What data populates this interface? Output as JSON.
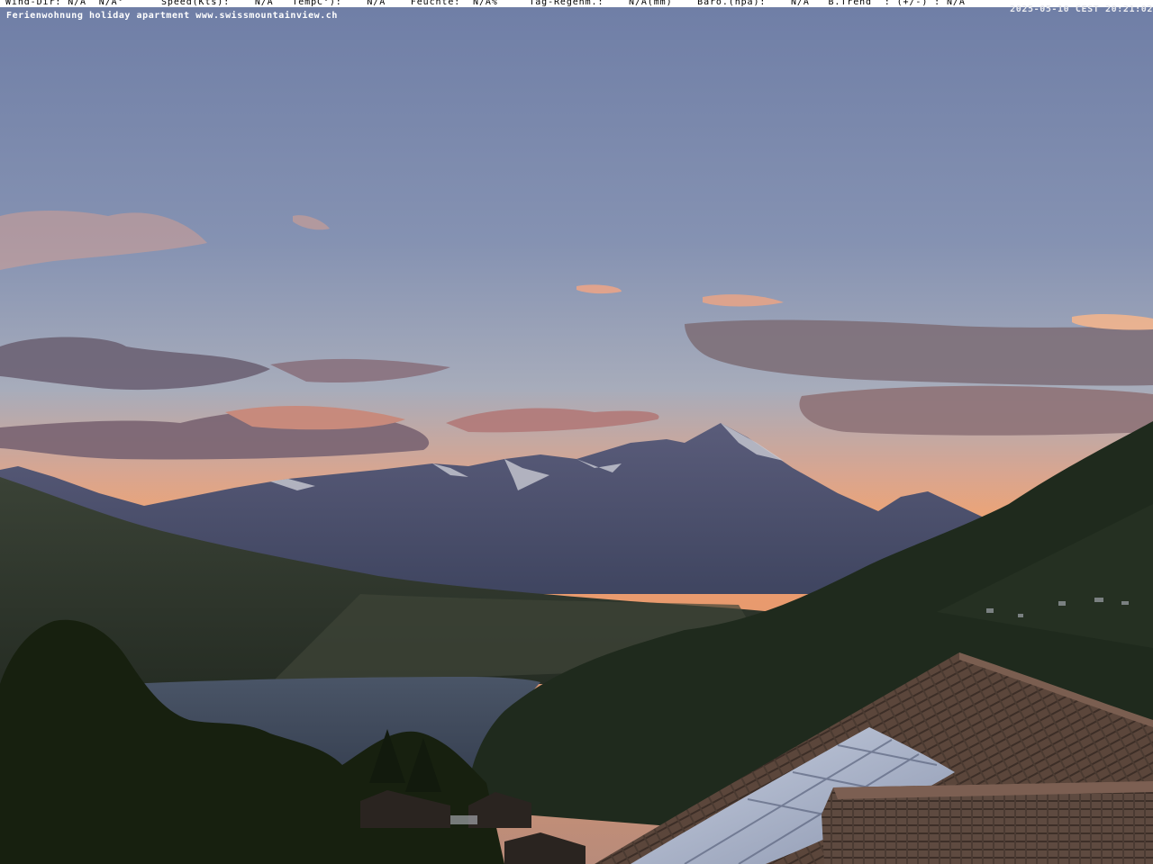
{
  "overlay": {
    "weather_line": "Wind-Dir: N/A  N/A°      Speed(Kts):    N/A   TempC°):    N/A    Feuchte:  N/A%     Tag-Regenm.:    N/A(mm)    Baro.(hpa):    N/A   B.Trend  : (+/-) : N/A",
    "caption": "Ferienwohnung holiday apartment www.swissmountainview.ch",
    "timestamp": "2025-05-10 CEST 20:21:02"
  },
  "scene": {
    "description_icons": [
      "sky-gradient",
      "cloud-bands",
      "mountain-range",
      "lake",
      "forest-slope",
      "tiled-roof",
      "solar-panels"
    ],
    "colors": {
      "sky_top": "#7281a8",
      "sky_mid": "#9aa6bb",
      "sky_horizon": "#f2a06d",
      "cloud_dark": "#6d6476",
      "cloud_lit": "#e39a7f",
      "far_mountains": "#4b4f6e",
      "mid_hills": "#313a33",
      "lake": "#3c4658",
      "dark_foreground": "#1b2418",
      "roof_tiles": "#5a463c",
      "solar_glass": "#aab3c8"
    }
  }
}
